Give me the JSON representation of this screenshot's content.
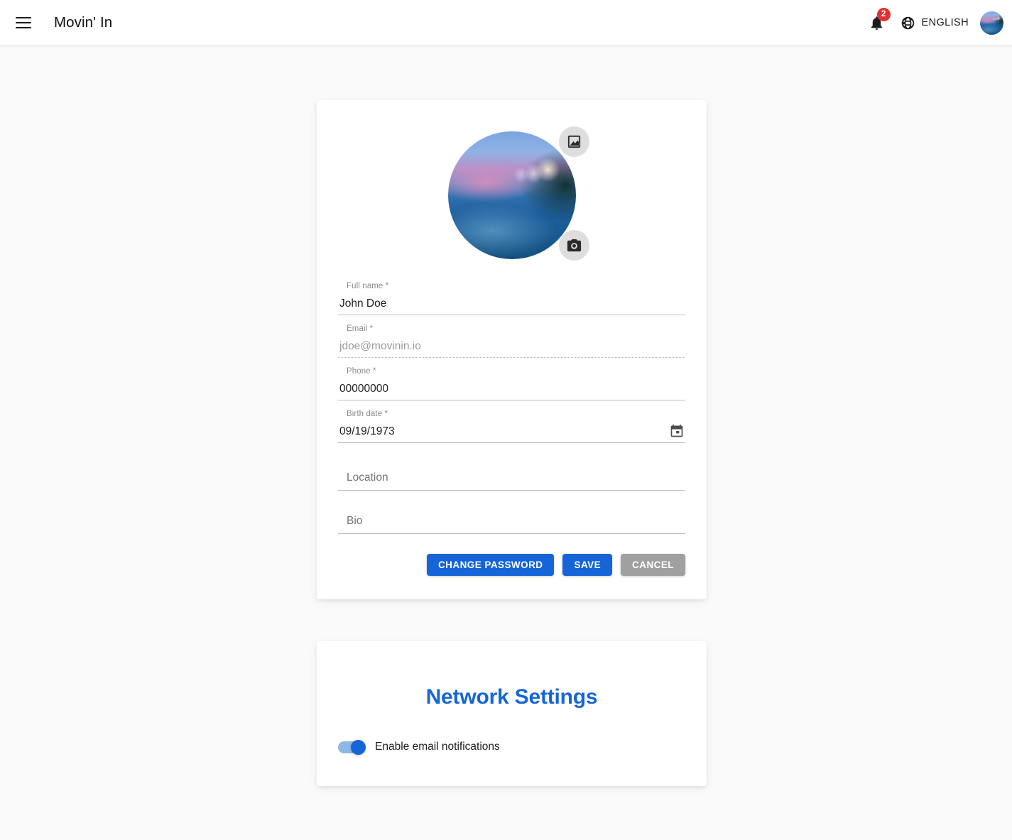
{
  "header": {
    "menu_icon": "hamburger-menu-icon",
    "title": "Movin' In",
    "notifications": {
      "icon": "bell-icon",
      "count": "2"
    },
    "language": {
      "icon": "globe-icon",
      "label": "ENGLISH"
    },
    "avatar_icon": "user-avatar"
  },
  "profile": {
    "avatar": {
      "image_button_icon": "image-icon",
      "camera_button_icon": "camera-icon"
    },
    "fields": {
      "full_name": {
        "label": "Full name *",
        "value": "John Doe"
      },
      "email": {
        "label": "Email *",
        "value": "jdoe@movinin.io",
        "disabled": "true"
      },
      "phone": {
        "label": "Phone *",
        "value": "00000000"
      },
      "birth_date": {
        "label": "Birth date *",
        "value": "09/19/1973",
        "icon": "calendar-icon"
      },
      "location": {
        "label": "",
        "placeholder": "Location",
        "value": ""
      },
      "bio": {
        "label": "",
        "placeholder": "Bio",
        "value": ""
      }
    },
    "buttons": {
      "change_password": "CHANGE PASSWORD",
      "save": "SAVE",
      "cancel": "CANCEL"
    }
  },
  "network_settings": {
    "title": "Network Settings",
    "email_notifications": {
      "label": "Enable email notifications",
      "enabled": "true"
    }
  },
  "colors": {
    "primary": "#1565d8",
    "grey_button": "#a0a0a0",
    "badge_red": "#e03131",
    "page_background": "#fafafa",
    "card_background": "#ffffff"
  }
}
